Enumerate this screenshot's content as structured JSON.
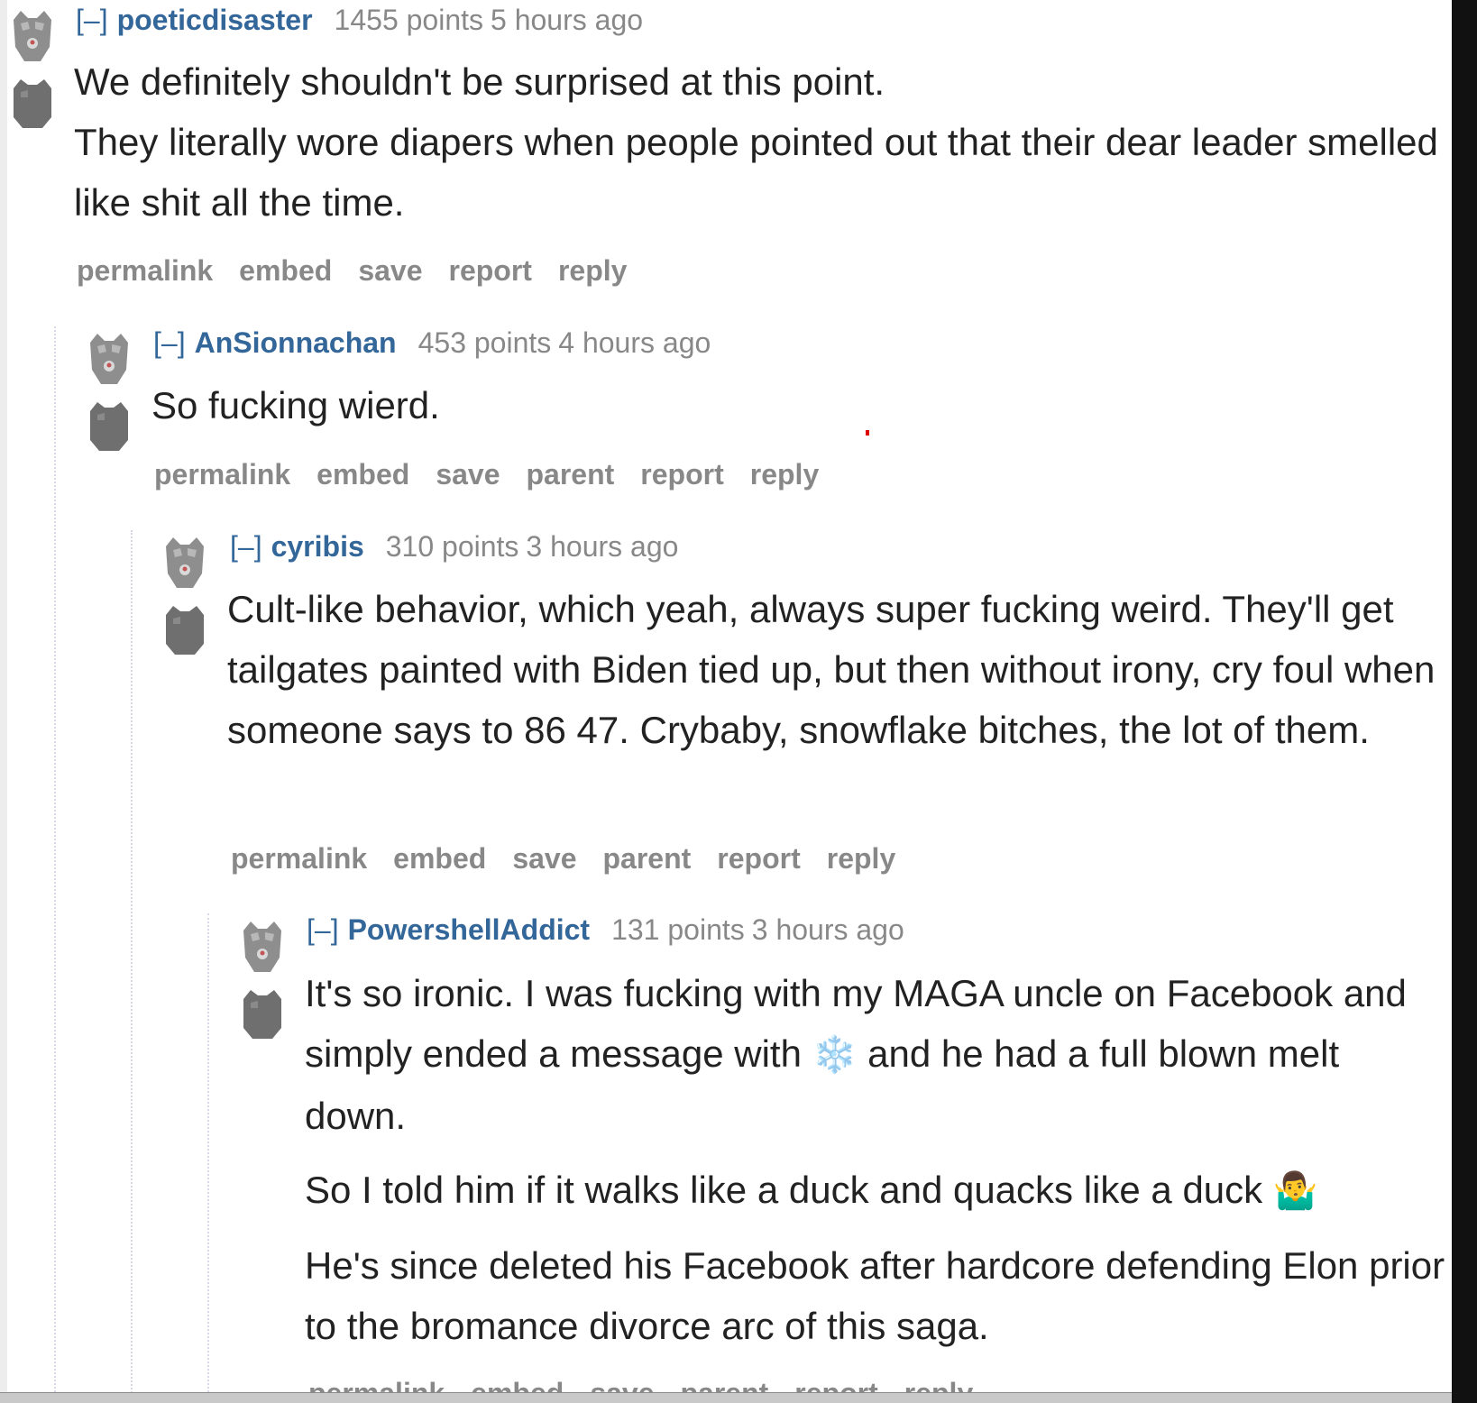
{
  "colors": {
    "link": "#336699",
    "muted": "#888888",
    "text": "#222222",
    "thread_line": "#d8d8e8"
  },
  "comments": [
    {
      "collapse": "[–]",
      "author": "poeticdisaster",
      "score": "1455 points",
      "time": "5 hours ago",
      "paragraphs": [
        "We definitely shouldn't be surprised at this point.",
        "They literally wore diapers when people pointed out that their dear leader smelled like shit all the time."
      ],
      "buttons": [
        "permalink",
        "embed",
        "save",
        "report",
        "reply"
      ]
    },
    {
      "collapse": "[–]",
      "author": "AnSionnachan",
      "score": "453 points",
      "time": "4 hours ago",
      "paragraphs": [
        "So fucking wierd."
      ],
      "buttons": [
        "permalink",
        "embed",
        "save",
        "parent",
        "report",
        "reply"
      ]
    },
    {
      "collapse": "[–]",
      "author": "cyribis",
      "score": "310 points",
      "time": "3 hours ago",
      "paragraphs": [
        "Cult-like behavior, which yeah, always super fucking weird. They'll get tailgates painted with Biden tied up, but then without irony, cry foul when someone says to 86 47. Crybaby, snowflake bitches, the lot of them."
      ],
      "buttons": [
        "permalink",
        "embed",
        "save",
        "parent",
        "report",
        "reply"
      ]
    },
    {
      "collapse": "[–]",
      "author": "PowershellAddict",
      "score": "131 points",
      "time": "3 hours ago",
      "p1_before": "It's so ironic. I was fucking with my MAGA uncle on Facebook and simply ended a message with",
      "p1_emoji": "❄️",
      "p1_after": "and he had a full blown melt down.",
      "p2_text": "So I told him if it walks like a duck and quacks like a duck",
      "p2_emoji": "🤷‍♂️",
      "p3": "He's since deleted his Facebook after hardcore defending Elon prior to the bromance divorce arc of this saga.",
      "buttons": [
        "permalink",
        "embed",
        "save",
        "parent",
        "report",
        "reply"
      ]
    }
  ]
}
